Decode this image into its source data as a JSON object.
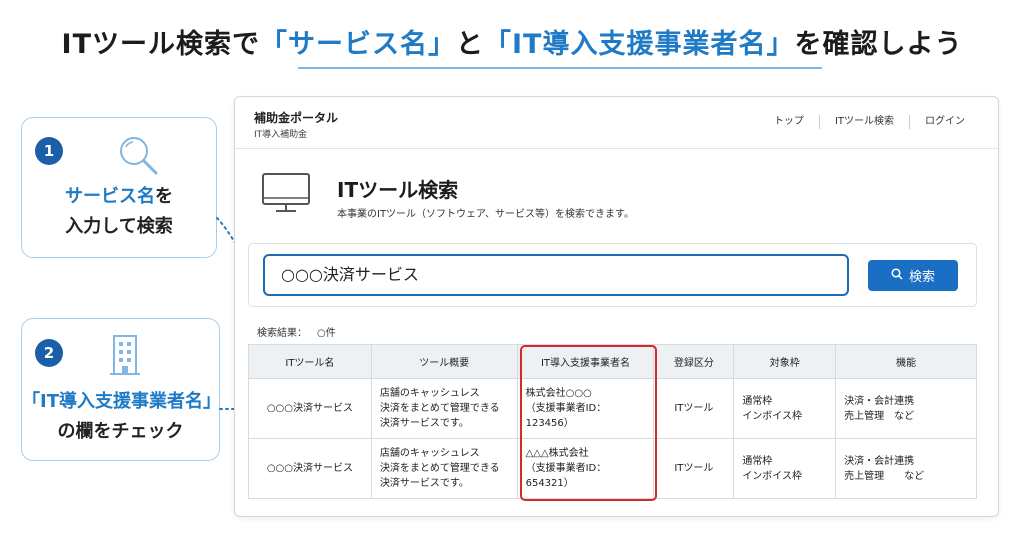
{
  "headline": {
    "part1": "ITツール検索で",
    "part2": "「サービス名」",
    "part3": "と",
    "part4": "「IT導入支援事業者名」",
    "part5": "を確認しよう"
  },
  "callout1": {
    "number": "1",
    "icon": "search-icon",
    "line1_highlight": "サービス名",
    "line1_rest": "を",
    "line2": "入力して検索"
  },
  "callout2": {
    "number": "2",
    "icon": "building-icon",
    "line1_highlight": "「IT導入支援事業者名」",
    "line2": "の欄をチェック"
  },
  "portal": {
    "title": "補助金ポータル",
    "subtitle": "IT導入補助金",
    "nav": [
      "トップ",
      "ITツール検索",
      "ログイン"
    ],
    "page_title": "ITツール検索",
    "page_desc": "本事業のITツール（ソフトウェア、サービス等）を検索できます。",
    "search_value": "○○○決済サービス",
    "search_button": "検索",
    "results_label": "検索結果：",
    "results_count": "○件"
  },
  "table": {
    "headers": [
      "ITツール名",
      "ツール概要",
      "IT導入支援事業者名",
      "登録区分",
      "対象枠",
      "機能"
    ],
    "rows": [
      [
        "○○○決済サービス",
        "店舗のキャッシュレス\n決済をまとめて管理できる\n決済サービスです。",
        "株式会社○○○\n（支援事業者ID：123456）",
        "ITツール",
        "通常枠\nインボイス枠",
        "決済・会計連携\n売上管理　など"
      ],
      [
        "○○○決済サービス",
        "店舗のキャッシュレス\n決済をまとめて管理できる\n決済サービスです。",
        "△△△株式会社\n（支援事業者ID：654321）",
        "ITツール",
        "通常枠\nインボイス枠",
        "決済・会計連携\n売上管理　　など"
      ]
    ]
  },
  "colors": {
    "accent": "#1f7bc6",
    "button": "#1a6fc4",
    "step_badge": "#1a5fa8",
    "highlight_border": "#d32b2b"
  }
}
